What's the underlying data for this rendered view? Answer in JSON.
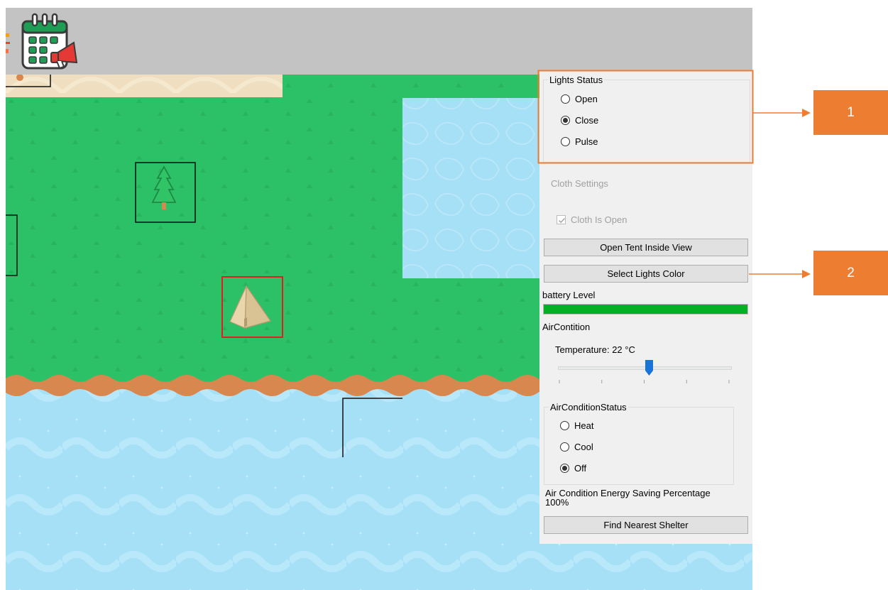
{
  "colors": {
    "grass": "#2dc167",
    "water": "#a5e0f7",
    "sand": "#efdfc0",
    "shore": "#d8884f",
    "toolbar": "#c3c3c3",
    "panel": "#f0f0f0",
    "accent_orange": "#ed7d31",
    "battery_green": "#06b025",
    "selection_red": "#e02020",
    "slider_thumb": "#1a73d8"
  },
  "icons": {
    "toolbar_left": "partial-toolbar-icon",
    "toolbar_main": "calendar-announcement-icon",
    "map_tree": "pine-tree-icon",
    "map_tent": "tent-icon"
  },
  "panel": {
    "lights_group": {
      "title": "Lights Status",
      "options": [
        {
          "label": "Open",
          "checked": false
        },
        {
          "label": "Close",
          "checked": true
        },
        {
          "label": "Pulse",
          "checked": false
        }
      ]
    },
    "cloth_settings": {
      "title": "Cloth Settings",
      "checkbox_label": "Cloth Is Open",
      "checked": true,
      "enabled": false
    },
    "open_tent_button": "Open Tent Inside View",
    "select_lights_color_button": "Select Lights Color",
    "battery": {
      "label": "battery Level",
      "level_percent": 100
    },
    "aircondition": {
      "label": "AirContition",
      "temperature_label": "Temperature: 22 °C",
      "slider_value_fraction": 0.53,
      "tick_count": 5
    },
    "aircondition_status": {
      "title": "AirConditionStatus",
      "options": [
        {
          "label": "Heat",
          "checked": false
        },
        {
          "label": "Cool",
          "checked": false
        },
        {
          "label": "Off",
          "checked": true
        }
      ]
    },
    "energy_saving": {
      "label": "Air Condition Energy Saving Percentage",
      "value": "100%"
    },
    "find_shelter_button": "Find Nearest Shelter"
  },
  "callouts": [
    {
      "number": "1"
    },
    {
      "number": "2"
    }
  ]
}
